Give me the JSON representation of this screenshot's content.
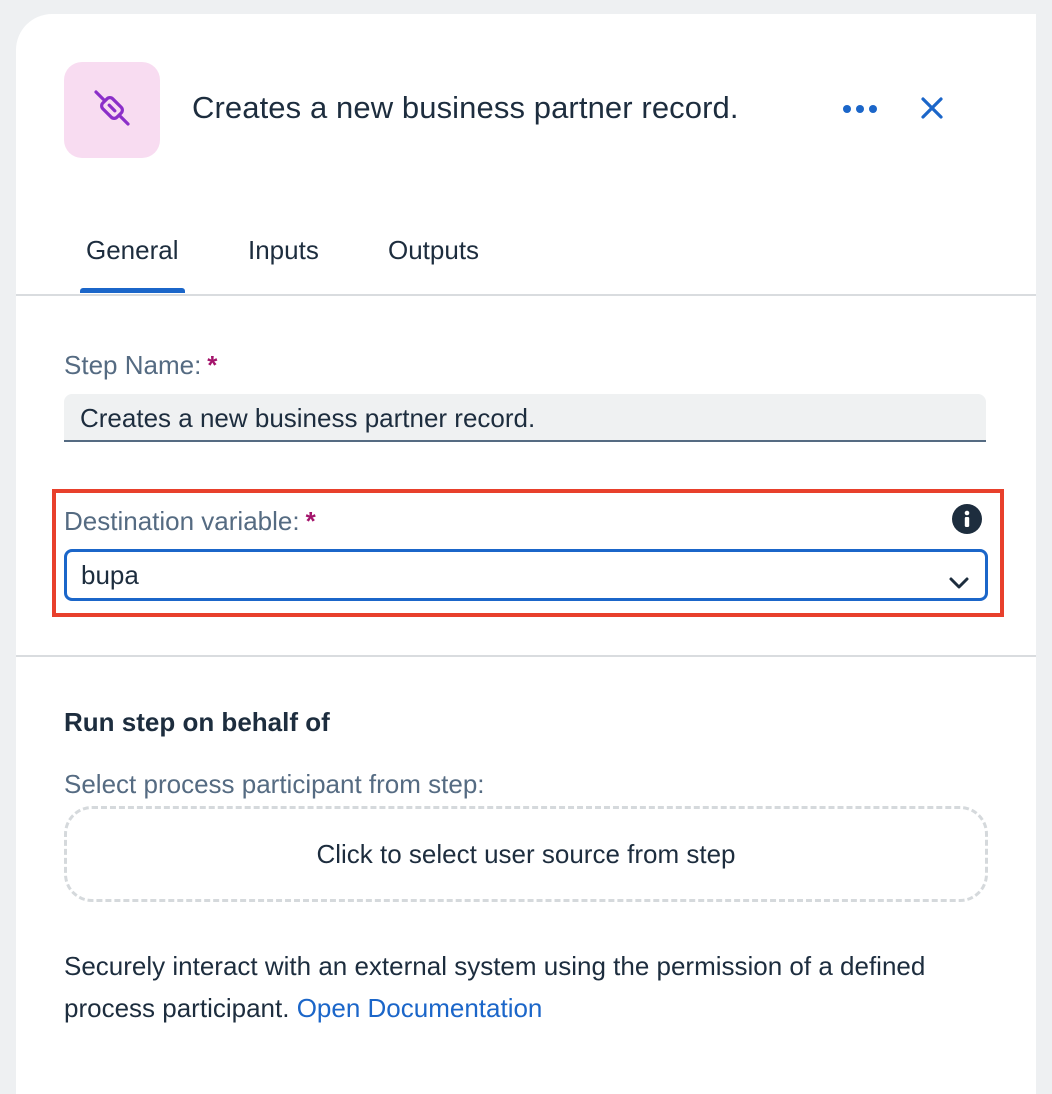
{
  "header": {
    "icon": "connector-plug-icon",
    "title": "Creates a new business partner record.",
    "more_icon": "more-horizontal-icon",
    "close_icon": "close-icon"
  },
  "tabs": [
    {
      "label": "General",
      "active": true
    },
    {
      "label": "Inputs",
      "active": false
    },
    {
      "label": "Outputs",
      "active": false
    }
  ],
  "general": {
    "step_name_label": "Step Name:",
    "step_name_value": "Creates a new business partner record.",
    "destination_label": "Destination variable:",
    "destination_value": "bupa",
    "required_mark": "*"
  },
  "run_on_behalf": {
    "title": "Run step on behalf of",
    "select_label": "Select process participant from step:",
    "dropzone_text": "Click to select user source from step",
    "description": "Securely interact with an external system using the permission of a defined process participant.",
    "link_text": "Open Documentation"
  },
  "colors": {
    "accent": "#1b66c9",
    "highlight": "#e8402c",
    "icon_bg": "#f8dcf1",
    "icon_fg": "#8b2fc9"
  }
}
